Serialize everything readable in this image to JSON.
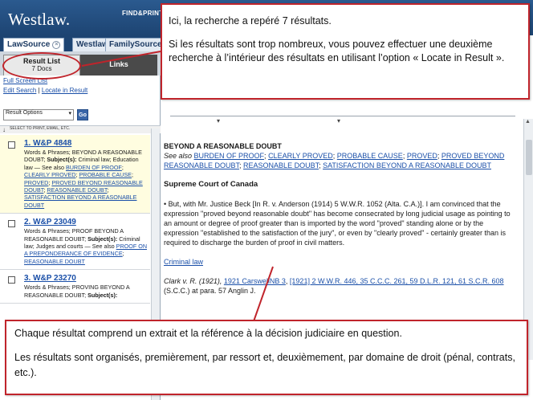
{
  "app": {
    "logo_text": "Westlaw.",
    "top_link": "FIND&PRINT"
  },
  "tabs": [
    "LawSource",
    "Westlaw",
    "FamilySource"
  ],
  "left": {
    "result_list_label": "Result List",
    "doc_count": "7 Docs",
    "links_tab": "Links",
    "full_screen": "Full Screen List",
    "edit_search": "Edit Search",
    "link_separator": "|",
    "locate_in_result": "Locate in Result",
    "result_options": "Result Options",
    "go": "Go",
    "select_hint": "SELECT TO PRINT, EMAIL, ETC."
  },
  "results": [
    {
      "title": "1. W&P 4848",
      "pre": "Words & Phrases; BEYOND A REASONABLE DOUBT; ",
      "subject_label": "Subject(s):",
      "subject": " Criminal law; Education law — See also ",
      "links": [
        "BURDEN OF PROOF",
        "CLEARLY PROVED",
        "PROBABLE CAUSE",
        "PROVED",
        "PROVED BEYOND REASONABLE DOUBT",
        "REASONABLE DOUBT",
        "SATISFACTION BEYOND A REASONABLE DOUBT"
      ],
      "highlight": true
    },
    {
      "title": "2. W&P 23049",
      "pre": "Words & Phrases; PROOF BEYOND A REASONABLE DOUBT; ",
      "subject_label": "Subject(s):",
      "subject": " Criminal law; Judges and courts — See also ",
      "links": [
        "PROOF ON A PREPONDERANCE OF EVIDENCE",
        "REASONABLE DOUBT"
      ],
      "highlight": false
    },
    {
      "title": "3. W&P 23270",
      "pre": "Words & Phrases; PROVING BEYOND A REASONABLE DOUBT; ",
      "subject_label": "Subject(s):",
      "subject": " ",
      "links": [],
      "highlight": false
    }
  ],
  "doc": {
    "heading": "BEYOND A REASONABLE DOUBT",
    "see_also": "See also ",
    "see_also_links": [
      "BURDEN OF PROOF",
      "CLEARLY PROVED",
      "PROBABLE CAUSE",
      "PROVED",
      "PROVED BEYOND REASONABLE DOUBT",
      "REASONABLE DOUBT",
      "SATISFACTION BEYOND A REASONABLE DOUBT"
    ],
    "court": "Supreme Court of Canada",
    "para": "• But, with Mr. Justice Beck [In R. v. Anderson (1914) 5 W.W.R. 1052 (Alta. C.A.)]. I am convinced that the expression \"proved beyond reasonable doubt\" has become consecrated by long judicial usage as pointing to an amount or degree of proof greater than is imported by the word \"proved\" standing alone or by the expression \"established to the satisfaction of the jury\", or even by \"clearly proved\" - certainly greater than is required to discharge the burden of proof in civil matters.",
    "criminal_law": "Criminal law",
    "clark_pre": "Clark v. R. (1921), ",
    "clark_link1": "1921 CarswellNB 3",
    "clark_mid": ", ",
    "clark_link2": "[1921] 2 W.W.R. 446, 35 C.C.C. 261, 59 D.L.R. 121, 61 S.C.R. 608",
    "clark_post": " (S.C.C.) at para. 57 Anglin J."
  },
  "callout_top": {
    "line1": "Ici, la recherche a repéré 7 résultats.",
    "line2": "Si les résultats sont trop nombreux, vous pouvez effectuer une deuxième recherche à l’intérieur des résultats en utilisant l’option « Locate in Result »."
  },
  "callout_bottom": {
    "line1": "Chaque résultat comprend un extrait et la référence à la décision judiciaire en question.",
    "line2": "Les résultats sont organisés, premièrement, par ressort et, deuxièmement, par domaine de droit (pénal, contrats, etc.)."
  },
  "colors": {
    "accent_red": "#c0242b",
    "link_blue": "#1a4fa8",
    "header_blue": "#1d4472",
    "highlight": "#fffde0"
  }
}
